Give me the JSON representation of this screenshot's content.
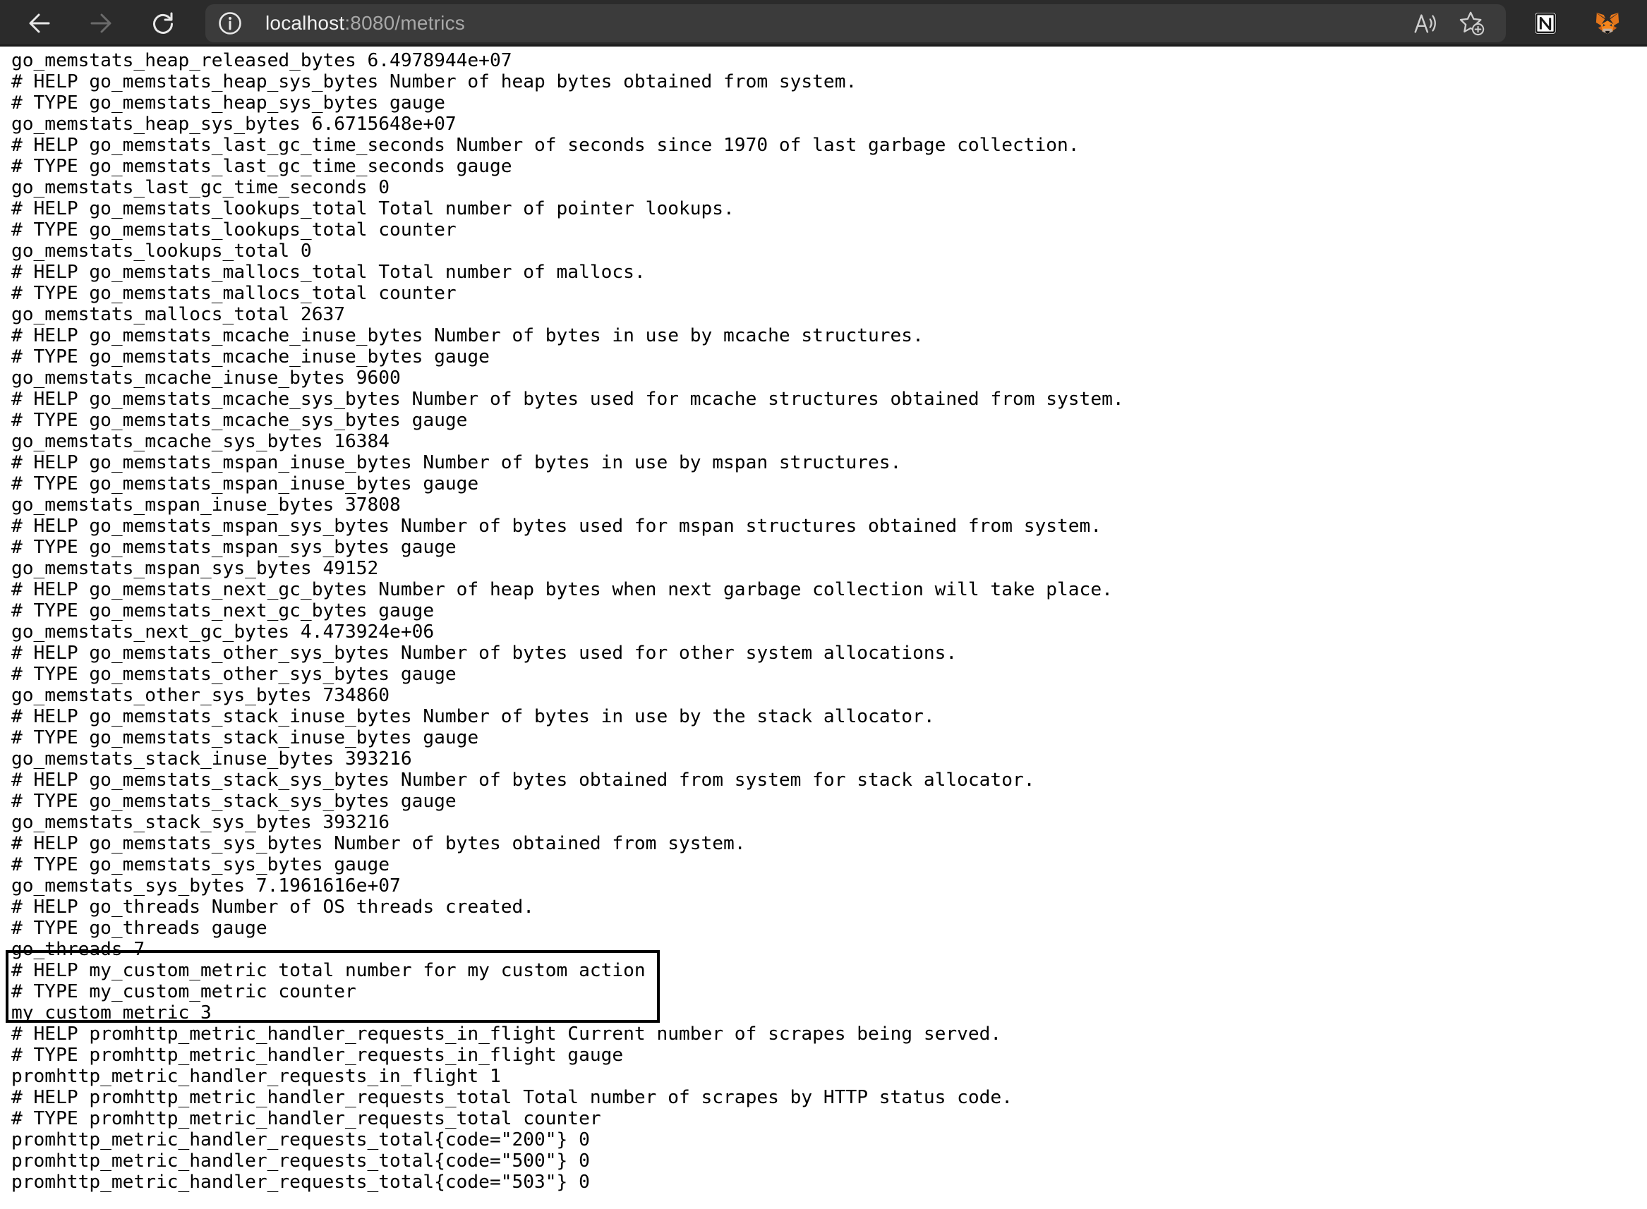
{
  "browser": {
    "url_host": "localhost",
    "url_path": ":8080/metrics",
    "icons": {
      "back": "back-arrow-icon",
      "forward": "forward-arrow-icon",
      "refresh": "refresh-icon",
      "site_info": "info-icon",
      "read_aloud": "read-aloud-icon",
      "favorites": "favorites-add-icon",
      "notion": "notion-extension-icon",
      "metamask": "metamask-extension-icon"
    },
    "colors": {
      "toolbar_bg": "#2b2b2b",
      "address_bg": "#3b3b3b",
      "url_host": "#f1f1f1",
      "url_path": "#a8a8a8"
    }
  },
  "metrics_lines": [
    "go_memstats_heap_released_bytes 6.4978944e+07",
    "# HELP go_memstats_heap_sys_bytes Number of heap bytes obtained from system.",
    "# TYPE go_memstats_heap_sys_bytes gauge",
    "go_memstats_heap_sys_bytes 6.6715648e+07",
    "# HELP go_memstats_last_gc_time_seconds Number of seconds since 1970 of last garbage collection.",
    "# TYPE go_memstats_last_gc_time_seconds gauge",
    "go_memstats_last_gc_time_seconds 0",
    "# HELP go_memstats_lookups_total Total number of pointer lookups.",
    "# TYPE go_memstats_lookups_total counter",
    "go_memstats_lookups_total 0",
    "# HELP go_memstats_mallocs_total Total number of mallocs.",
    "# TYPE go_memstats_mallocs_total counter",
    "go_memstats_mallocs_total 2637",
    "# HELP go_memstats_mcache_inuse_bytes Number of bytes in use by mcache structures.",
    "# TYPE go_memstats_mcache_inuse_bytes gauge",
    "go_memstats_mcache_inuse_bytes 9600",
    "# HELP go_memstats_mcache_sys_bytes Number of bytes used for mcache structures obtained from system.",
    "# TYPE go_memstats_mcache_sys_bytes gauge",
    "go_memstats_mcache_sys_bytes 16384",
    "# HELP go_memstats_mspan_inuse_bytes Number of bytes in use by mspan structures.",
    "# TYPE go_memstats_mspan_inuse_bytes gauge",
    "go_memstats_mspan_inuse_bytes 37808",
    "# HELP go_memstats_mspan_sys_bytes Number of bytes used for mspan structures obtained from system.",
    "# TYPE go_memstats_mspan_sys_bytes gauge",
    "go_memstats_mspan_sys_bytes 49152",
    "# HELP go_memstats_next_gc_bytes Number of heap bytes when next garbage collection will take place.",
    "# TYPE go_memstats_next_gc_bytes gauge",
    "go_memstats_next_gc_bytes 4.473924e+06",
    "# HELP go_memstats_other_sys_bytes Number of bytes used for other system allocations.",
    "# TYPE go_memstats_other_sys_bytes gauge",
    "go_memstats_other_sys_bytes 734860",
    "# HELP go_memstats_stack_inuse_bytes Number of bytes in use by the stack allocator.",
    "# TYPE go_memstats_stack_inuse_bytes gauge",
    "go_memstats_stack_inuse_bytes 393216",
    "# HELP go_memstats_stack_sys_bytes Number of bytes obtained from system for stack allocator.",
    "# TYPE go_memstats_stack_sys_bytes gauge",
    "go_memstats_stack_sys_bytes 393216",
    "# HELP go_memstats_sys_bytes Number of bytes obtained from system.",
    "# TYPE go_memstats_sys_bytes gauge",
    "go_memstats_sys_bytes 7.1961616e+07",
    "# HELP go_threads Number of OS threads created.",
    "# TYPE go_threads gauge",
    "go_threads 7",
    "# HELP my_custom_metric total number for my custom action",
    "# TYPE my_custom_metric counter",
    "my_custom_metric 3",
    "# HELP promhttp_metric_handler_requests_in_flight Current number of scrapes being served.",
    "# TYPE promhttp_metric_handler_requests_in_flight gauge",
    "promhttp_metric_handler_requests_in_flight 1",
    "# HELP promhttp_metric_handler_requests_total Total number of scrapes by HTTP status code.",
    "# TYPE promhttp_metric_handler_requests_total counter",
    "promhttp_metric_handler_requests_total{code=\"200\"} 0",
    "promhttp_metric_handler_requests_total{code=\"500\"} 0",
    "promhttp_metric_handler_requests_total{code=\"503\"} 0"
  ]
}
